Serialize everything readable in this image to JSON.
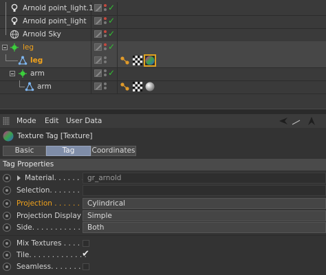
{
  "object_manager": {
    "objects": [
      {
        "name": "Arnold point_light.1",
        "icon": "light-bulb-icon"
      },
      {
        "name": "Arnold point_light",
        "icon": "light-bulb-icon"
      },
      {
        "name": "Arnold Sky",
        "icon": "sky-sphere-icon"
      },
      {
        "name": "leg",
        "icon": "null-object-icon",
        "highlight": true
      },
      {
        "name": "leg",
        "icon": "joint-icon",
        "highlight": true,
        "selected": true
      },
      {
        "name": "arm",
        "icon": "null-object-icon"
      },
      {
        "name": "arm",
        "icon": "joint-icon"
      }
    ],
    "colors": {
      "selection": "#f0a21c",
      "check": "#34c134"
    }
  },
  "attribute_manager": {
    "menu": {
      "mode": "Mode",
      "edit": "Edit",
      "user_data": "User Data"
    },
    "tag_title": "Texture Tag [Texture]",
    "tabs": [
      {
        "label": "Basic",
        "active": false
      },
      {
        "label": "Tag",
        "active": true
      },
      {
        "label": "Coordinates",
        "active": false
      }
    ],
    "section_title": "Tag Properties",
    "properties": {
      "material": {
        "label": "Material. . . . . . . .",
        "value": "gr_arnold"
      },
      "selection": {
        "label": "Selection. . . . . . . .",
        "value": ""
      },
      "projection": {
        "label": "Projection . . . . . . . .",
        "value": "Cylindrical"
      },
      "projection_display": {
        "label": "Projection Display",
        "value": "Simple"
      },
      "side": {
        "label": "Side. . . . . . . . . . . . .",
        "value": "Both"
      }
    },
    "options": {
      "mix_textures": {
        "label": "Mix Textures . . . . . .",
        "checked": false
      },
      "tile": {
        "label": "Tile. . . . . . . . . . . . .",
        "checked": true,
        "mark": "✔"
      },
      "seamless": {
        "label": "Seamless. . . . . . . .",
        "checked": false
      }
    }
  }
}
